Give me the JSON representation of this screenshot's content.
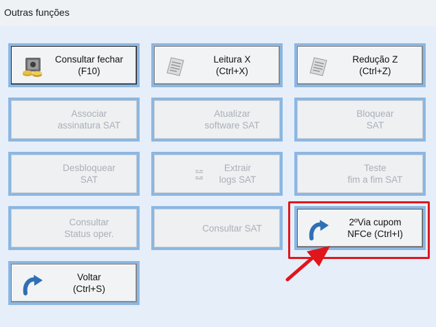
{
  "window": {
    "title": "Outras funções"
  },
  "buttons": {
    "consultar_fechar": {
      "label": "Consultar fechar\n(F10)",
      "icon": "safe-money-icon"
    },
    "leitura_x": {
      "label": "Leitura X\n(Ctrl+X)",
      "icon": "receipt-icon"
    },
    "reducao_z": {
      "label": "Redução Z\n(Ctrl+Z)",
      "icon": "receipt-icon"
    },
    "associar_sat": {
      "label": "Associar\nassinatura SAT"
    },
    "atualizar_sat": {
      "label": "Atualizar\nsoftware SAT"
    },
    "bloquear_sat": {
      "label": "Bloquear\nSAT"
    },
    "desbloquear_sat": {
      "label": "Desbloquear\nSAT"
    },
    "extrair_logs": {
      "label": "Extrair\nlogs SAT",
      "icon": "log-lines-icon"
    },
    "teste_sat": {
      "label": "Teste\nfim a fim SAT"
    },
    "consultar_status": {
      "label": "Consultar\nStatus oper."
    },
    "consultar_sat": {
      "label": "Consultar SAT"
    },
    "segunda_via": {
      "label": "2ºVia cupom\nNFCe (Ctrl+I)",
      "icon": "redo-arrow-icon"
    },
    "voltar": {
      "label": "Voltar\n(Ctrl+S)",
      "icon": "redo-arrow-icon"
    }
  },
  "colors": {
    "highlight": "#e0161b",
    "button_border": "#8bb7e2",
    "icon_blue": "#2f6fb5"
  }
}
